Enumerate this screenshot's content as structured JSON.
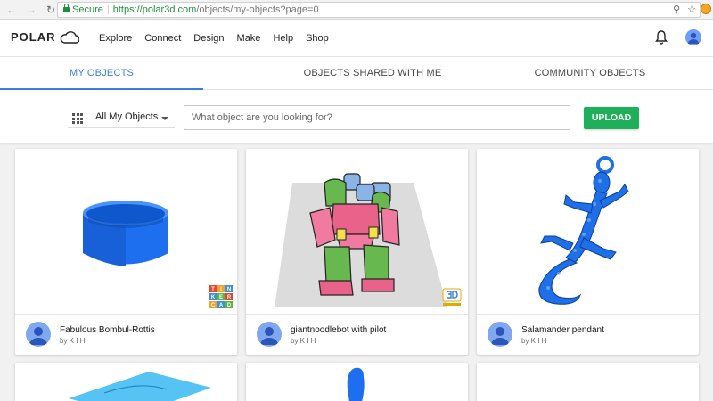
{
  "browser": {
    "secure_label": "Secure",
    "url_host": "https://polar3d.com",
    "url_path": "/objects/my-objects?page=0"
  },
  "header": {
    "logo_text": "POLAR",
    "menu": [
      "Explore",
      "Connect",
      "Design",
      "Make",
      "Help",
      "Shop"
    ]
  },
  "tabs": [
    {
      "label": "MY OBJECTS",
      "active": true
    },
    {
      "label": "OBJECTS SHARED WITH ME",
      "active": false
    },
    {
      "label": "COMMUNITY OBJECTS",
      "active": false
    }
  ],
  "toolbar": {
    "filter_value": "All My Objects",
    "search_placeholder": "What object are you looking for?",
    "upload_label": "UPLOAD"
  },
  "objects": [
    {
      "title": "Fabulous Bombul-Rottis",
      "owner": "by K I H",
      "badge": "tinkercad"
    },
    {
      "title": "giantnoodlebot with pilot",
      "owner": "by K I H",
      "badge": "3d-slash"
    },
    {
      "title": "Salamander pendant",
      "owner": "by K I H",
      "badge": ""
    }
  ],
  "tinkercad_letters": [
    "T",
    "I",
    "N",
    "K",
    "E",
    "R",
    "C",
    "A",
    "D"
  ],
  "colors": {
    "accent_blue": "#3b7ddd",
    "upload_green": "#1fae5a",
    "model_blue": "#1e6ff0"
  }
}
